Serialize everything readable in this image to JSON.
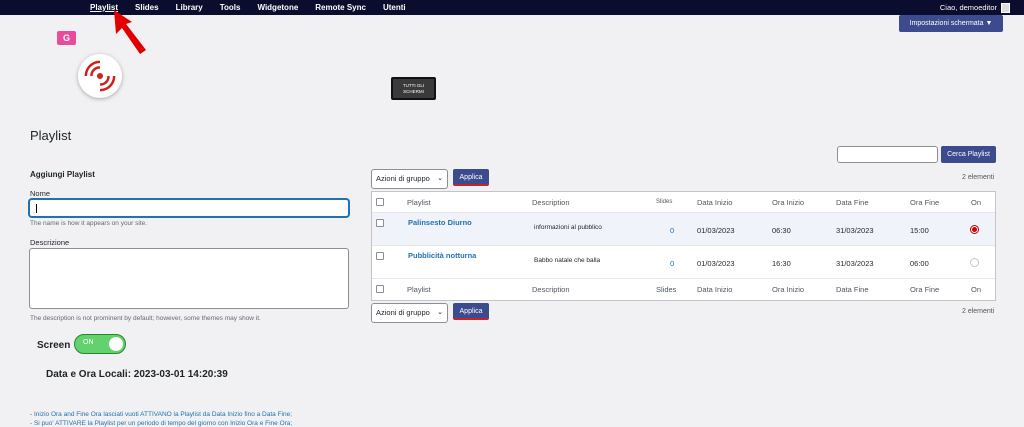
{
  "topnav": {
    "items": [
      "Playlist",
      "Slides",
      "Library",
      "Tools",
      "Widgetone",
      "Remote Sync",
      "Utenti"
    ],
    "greeting": "Ciao, demoeditor"
  },
  "screen_options": "Impostazioni schermata ▼",
  "all_screens_button": "TUTTI GLI SCHERMI",
  "logo_letter": "G",
  "page_title": "Playlist",
  "form": {
    "section_title": "Aggiungi Playlist",
    "name_label": "Nome",
    "name_value": "",
    "name_hint": "The name is how it appears on your site.",
    "description_label": "Descrizione",
    "description_hint": "The description is not prominent by default; however, some themes may show it."
  },
  "screen_toggle": {
    "label": "Screen",
    "state": "ON"
  },
  "datetime": "Data e Ora Locali: 2023-03-01 14:20:39",
  "notes": [
    "- Inizio Ora and Fine Ora lasciati vuoti ATTIVANO la Playlist da Data Inizio fino a Data Fine;",
    "- Si puo' ATTIVARE la Playlist per un periodo di tempo del giorno con Inizio Ora e Fine Ora;"
  ],
  "search": {
    "value": "",
    "button": "Cerca Playlist"
  },
  "bulk_actions": {
    "label": "Azioni di gruppo",
    "apply": "Applica"
  },
  "item_count": "2 elementi",
  "table": {
    "columns": [
      "Playlist",
      "Description",
      "Slides",
      "Data Inizio",
      "Ora Inizio",
      "Data Fine",
      "Ora Fine",
      "On"
    ],
    "header_slides_label": "Slides",
    "rows": [
      {
        "playlist": "Palinsesto Diurno",
        "description": "informazioni al pubblico",
        "slides": "0",
        "data_inizio": "01/03/2023",
        "ora_inizio": "06:30",
        "data_fine": "31/03/2023",
        "ora_fine": "15:00",
        "on": true
      },
      {
        "playlist": "Pubblicità notturna",
        "description": "Babbo natale che balla",
        "slides": "0",
        "data_inizio": "01/03/2023",
        "ora_inizio": "16:30",
        "data_fine": "31/03/2023",
        "ora_fine": "06:00",
        "on": false
      }
    ]
  },
  "colors": {
    "topbar": "#0b0d2e",
    "primary_button": "#3c4a8e",
    "link": "#2271b1",
    "toggle_on": "#63d26e",
    "active_radio": "#d40000",
    "annotation_arrow": "#e00000"
  }
}
